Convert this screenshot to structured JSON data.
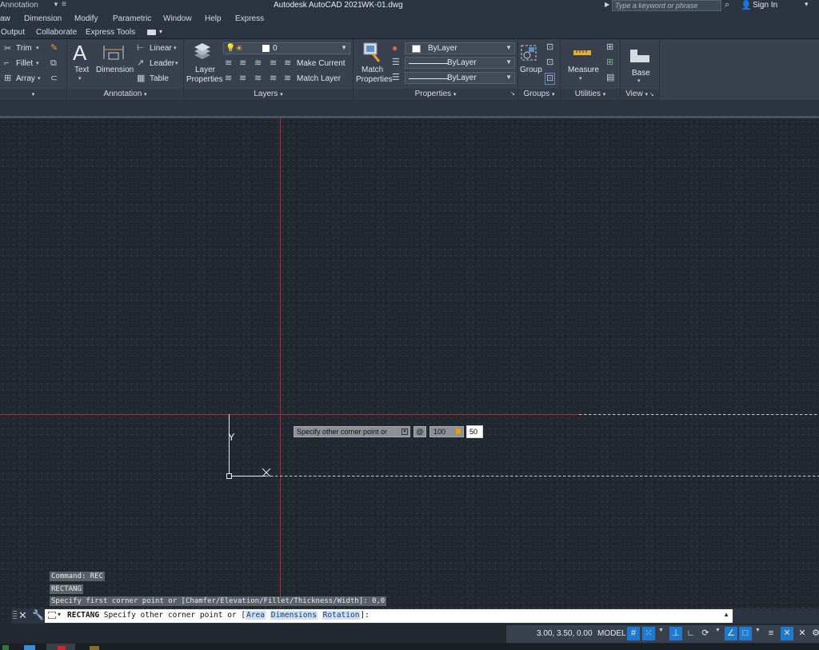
{
  "titlebar": {
    "workspace": "Annotation",
    "app_title": "Autodesk AutoCAD 2021",
    "document": "WK-01.dwg",
    "search_placeholder": "Type a keyword or phrase",
    "sign_in": "Sign In"
  },
  "menubar": [
    "aw",
    "Dimension",
    "Modify",
    "Parametric",
    "Window",
    "Help",
    "Express"
  ],
  "ribbon_tabs": [
    "Output",
    "Collaborate",
    "Express Tools"
  ],
  "ribbon": {
    "modify": {
      "trim": "Trim",
      "fillet": "Fillet",
      "array": "Array"
    },
    "annotation": {
      "title": "Annotation",
      "text": "Text",
      "dimension": "Dimension",
      "linear": "Linear",
      "leader": "Leader",
      "table": "Table"
    },
    "layers": {
      "title": "Layers",
      "layer_properties_1": "Layer",
      "layer_properties_2": "Properties",
      "current_layer": "0",
      "make_current": "Make Current",
      "match_layer": "Match Layer"
    },
    "properties": {
      "title": "Properties",
      "match_1": "Match",
      "match_2": "Properties",
      "color": "ByLayer",
      "linetype": "ByLayer",
      "lineweight": "ByLayer"
    },
    "groups": {
      "title": "Groups",
      "group": "Group"
    },
    "utilities": {
      "title": "Utilities",
      "measure": "Measure"
    },
    "view": {
      "title": "View",
      "base": "Base"
    }
  },
  "dynamic_input": {
    "prompt": "Specify other corner point or",
    "at_symbol": "@",
    "value1": "100",
    "value2": "50"
  },
  "ucs": {
    "y_label": "Y"
  },
  "command_history": [
    "Command: REC",
    "RECTANG",
    "Specify first corner point or [Chamfer/Elevation/Fillet/Thickness/Width]: 0,0"
  ],
  "command_line": {
    "command": "RECTANG",
    "prompt": "Specify other corner point or [",
    "options": [
      "Area",
      "Dimensions",
      "Rotation"
    ],
    "suffix": "]:"
  },
  "statusbar": {
    "coords": "3.00, 3.50, 0.00",
    "model": "MODEL"
  },
  "colors": {
    "crosshair": "#c8222a",
    "canvas": "#212830",
    "ribbon": "#38414d",
    "status_active": "#1e7ad0"
  }
}
